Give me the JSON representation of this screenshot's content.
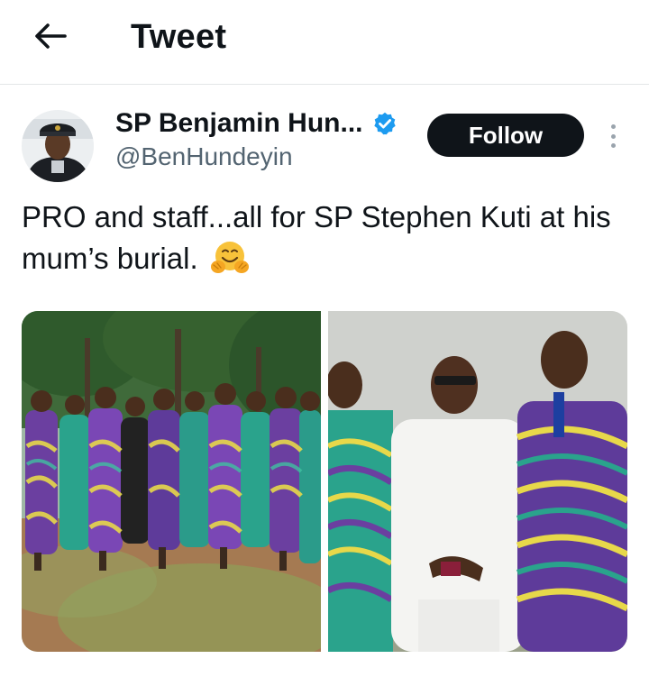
{
  "header": {
    "title": "Tweet",
    "back_icon": "arrow-left-icon"
  },
  "author": {
    "display_name": "SP Benjamin Hun...",
    "handle": "@BenHundeyin",
    "verified": true,
    "verified_color": "#1d9bf0",
    "avatar_icon": "profile-photo"
  },
  "actions": {
    "follow_label": "Follow",
    "more_icon": "more-vertical-icon"
  },
  "tweet": {
    "text": "PRO and staff...all for SP Stephen Kuti at his mum’s burial.",
    "emoji": "hugging-face-emoji"
  },
  "media": {
    "photos": [
      {
        "name": "group-photo",
        "description_icon": "group-of-people-in-matching-attire"
      },
      {
        "name": "three-men-photo",
        "description_icon": "three-men-standing"
      }
    ]
  },
  "colors": {
    "text_primary": "#0f1419",
    "text_secondary": "#536471",
    "follow_bg": "#0f1419",
    "follow_text": "#ffffff",
    "divider": "#e3e6e8"
  }
}
